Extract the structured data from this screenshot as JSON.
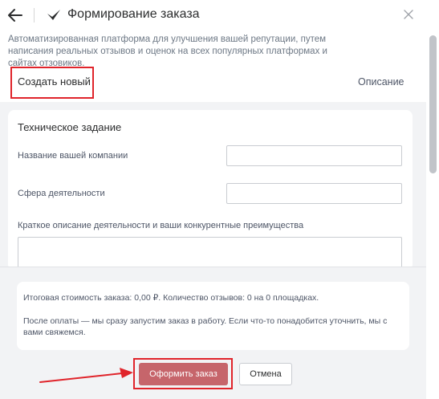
{
  "header": {
    "title": "Формирование заказа",
    "back_icon": "arrow-left-icon",
    "logo_icon": "checkmark-logo-icon",
    "close_icon": "close-icon"
  },
  "description": "Автоматизированная платформа для улучшения вашей репутации, путем написания реальных отзывов и оценок на всех популярных платформах и сайтах отзовиков.",
  "tabs": [
    {
      "label": "Создать новый",
      "active": true
    },
    {
      "label": "Описание",
      "active": false
    }
  ],
  "form": {
    "section_title": "Техническое задание",
    "fields": [
      {
        "label": "Название вашей компании",
        "value": "",
        "placeholder": ""
      },
      {
        "label": "Сфера деятельности",
        "value": "",
        "placeholder": ""
      },
      {
        "label": "Краткое описание деятельности и ваши конкурентные преимущества",
        "value": "",
        "placeholder": ""
      }
    ]
  },
  "summary": {
    "line1": "Итоговая стоимость заказа: 0,00 ₽. Количество отзывов: 0 на 0 площадках.",
    "line2": "После оплаты — мы сразу запустим заказ в работу. Если что-то понадобится уточнить, мы с вами свяжемся."
  },
  "buttons": {
    "order_label": "Оформить заказ",
    "cancel_label": "Отмена"
  },
  "colors": {
    "highlight": "#e0242b",
    "order_button": "#c6656b",
    "panel_bg": "#f2f3f5"
  }
}
